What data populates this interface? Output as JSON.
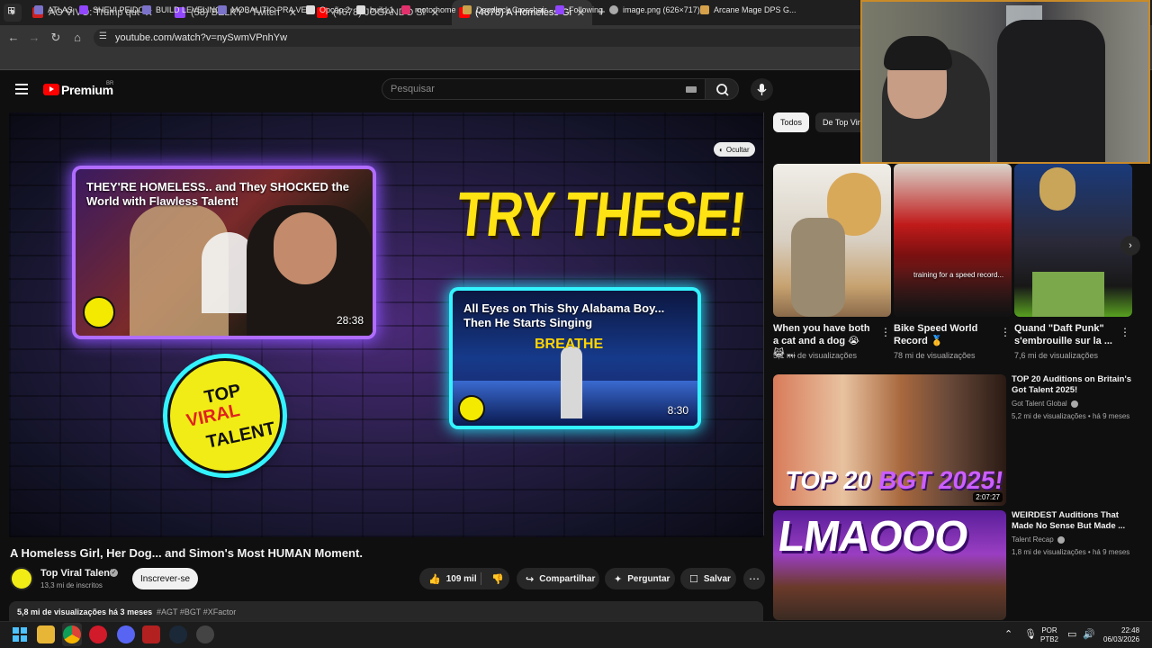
{
  "browser": {
    "tabs": [
      {
        "title": "AO VIVO: Trump quer 'rendição",
        "fav_color": "#cc1f1f"
      },
      {
        "title": "(58) BELKY - Twitch",
        "fav_color": "#9146ff"
      },
      {
        "title": "(4678) JOGANDO Slay the Spire",
        "fav_color": "#ff0000"
      },
      {
        "title": "(4678) A Homeless Girl, Her Dog",
        "fav_color": "#ff0000"
      }
    ],
    "new_tab": "+",
    "url": "youtube.com/watch?v=nySwmVPnhYw",
    "bookmarks": [
      {
        "label": "ATLAS",
        "color": "#7b72c9"
      },
      {
        "label": "SHEVI PEIDO",
        "color": "#9146ff"
      },
      {
        "label": "BUILD LEVELING",
        "color": "#7b72c9"
      },
      {
        "label": "MOBALITIC PRA VER",
        "color": "#7b72c9"
      },
      {
        "label": "Opção 2",
        "color": "#dddddd"
      },
      {
        "label": "build 1",
        "color": "#dddddd"
      },
      {
        "label": "motorhome",
        "color": "#e1306c"
      },
      {
        "label": "Deadlock Crosshair...",
        "color": "#c9a24b"
      },
      {
        "label": "Following",
        "color": "#9146ff"
      },
      {
        "label": "image.png (626×717)",
        "color": "#aaaaaa"
      },
      {
        "label": "Arcane Mage DPS G...",
        "color": "#d6a14a"
      }
    ]
  },
  "youtube": {
    "brand": "Premium",
    "country": "BR",
    "search_placeholder": "Pesquisar"
  },
  "player": {
    "hide_label": "Ocultar",
    "endscreen_heading": "TRY THESE!",
    "card1": {
      "title": "THEY'RE HOMELESS.. and They SHOCKED the World with Flawless Talent!",
      "duration": "28:38"
    },
    "card2": {
      "title": "All Eyes on This Shy Alabama Boy... Then He Starts Singing",
      "duration": "8:30",
      "overlay": "BREATHE"
    },
    "logo_lines": [
      "TOP",
      "VIRAL",
      "TALENT"
    ]
  },
  "video": {
    "title": "A Homeless Girl, Her Dog... and Simon's Most HUMAN Moment.",
    "channel": "Top Viral Talent",
    "subscribers": "13,3 mi de inscritos",
    "subscribe_label": "Inscrever-se",
    "likes": "109 mil",
    "share_label": "Compartilhar",
    "ask_label": "Perguntar",
    "save_label": "Salvar",
    "views_time": "5,8 mi de visualizações  há 3 meses",
    "tags": "#AGT #BGT #XFactor"
  },
  "sidebar": {
    "chips": [
      "Todos",
      "De Top Viral"
    ],
    "shorts": [
      {
        "title": "When you have both a cat and a dog 😭 😹 ...",
        "views": "5,1 mi de visualizações"
      },
      {
        "title": "Bike Speed World Record 🥇",
        "views": "78 mi de visualizações",
        "overlay": "training for a speed record..."
      },
      {
        "title": "Quand \"Daft Punk\" s'embrouille sur la ...",
        "views": "7,6 mi de visualizações"
      }
    ],
    "videos": [
      {
        "title": "TOP 20 Auditions on Britain's Got Talent 2025!",
        "channel": "Got Talent Global",
        "meta": "5,2 mi de visualizações • há 9 meses",
        "duration": "2:07:27",
        "overlay_a": "TOP 20 ",
        "overlay_b": "BGT 2025!"
      },
      {
        "title": "WEIRDEST Auditions That Made No Sense But Made ...",
        "channel": "Talent Recap",
        "meta": "1,8 mi de visualizações • há 9 meses",
        "overlay": "LMAOOO"
      }
    ]
  },
  "taskbar": {
    "lang": "POR",
    "layout": "PTB2",
    "time": "22:48",
    "date": "06/03/2026"
  }
}
